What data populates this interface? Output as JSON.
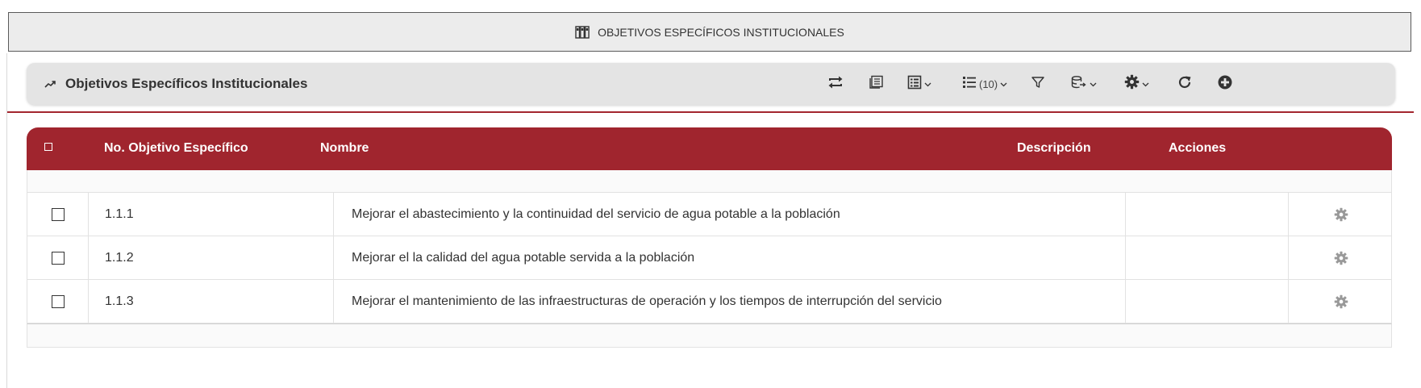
{
  "page_header": {
    "title": "OBJETIVOS ESPECÍFICOS INSTITUCIONALES",
    "icon": "binders-icon"
  },
  "toolbar": {
    "title": "Objetivos Específicos Institucionales",
    "title_icon": "trend-up-icon",
    "tools": [
      {
        "name": "swap-icon"
      },
      {
        "name": "notes-icon"
      },
      {
        "name": "table-columns-icon"
      },
      {
        "name": "list-icon",
        "count": "(10)"
      },
      {
        "name": "filter-icon"
      },
      {
        "name": "export-icon"
      },
      {
        "name": "gear-icon"
      },
      {
        "name": "refresh-icon"
      },
      {
        "name": "add-icon"
      }
    ]
  },
  "table": {
    "headers": [
      "No. Objetivo Específico",
      "Nombre",
      "Descripción",
      "Acciones"
    ],
    "rows": [
      {
        "no": "1.1.1",
        "nombre": "Mejorar el abastecimiento y la continuidad del servicio de agua potable a la población",
        "descripcion": ""
      },
      {
        "no": "1.1.2",
        "nombre": "Mejorar el la calidad del agua potable servida a la población",
        "descripcion": ""
      },
      {
        "no": "1.1.3",
        "nombre": "Mejorar el mantenimiento de las infraestructuras de operación y los tiempos de interrupción del servicio",
        "descripcion": ""
      }
    ]
  },
  "colors": {
    "accent": "#a0252e",
    "header_bg": "#ececec",
    "toolbar_bg": "#e4e4e4"
  }
}
